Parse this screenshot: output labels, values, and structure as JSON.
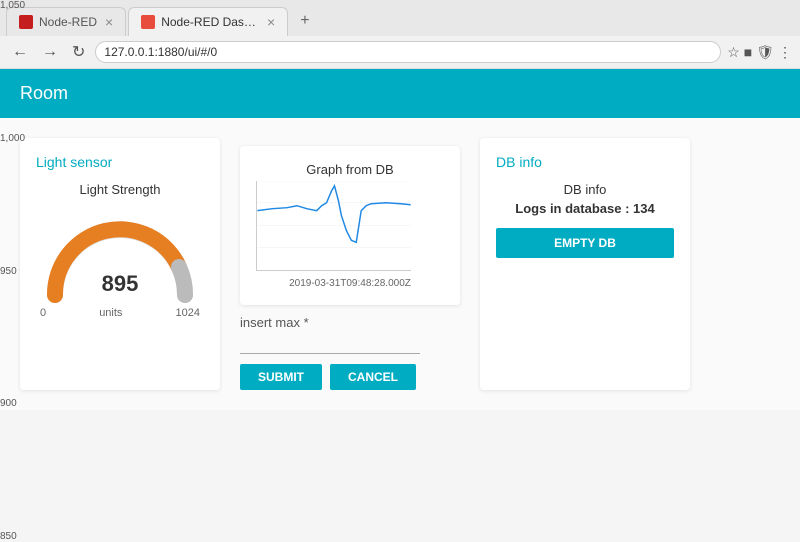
{
  "browser": {
    "tabs": [
      {
        "label": "Node-RED",
        "active": false,
        "favicon_color": "#c41e1e"
      },
      {
        "label": "Node-RED Dashb...",
        "active": true,
        "favicon_color": "#e74c3c"
      }
    ],
    "address": "127.0.0.1:1880/ui/#/0",
    "nav_back": "←",
    "nav_forward": "→",
    "nav_refresh": "↻"
  },
  "header": {
    "title": "Room"
  },
  "light_sensor": {
    "section_title": "Light sensor",
    "gauge_label": "Light Strength",
    "value": "895",
    "unit": "units",
    "range_min": "0",
    "range_max": "1024"
  },
  "graph": {
    "section_title": "Graph from DB",
    "timestamp": "2019-03-31T09:48:28.000Z",
    "y_labels": [
      "1,050",
      "1,000",
      "950",
      "900",
      "850"
    ]
  },
  "insert_form": {
    "label": "insert max *",
    "submit_label": "SUBMIT",
    "cancel_label": "CANCEL"
  },
  "db_info": {
    "section_title": "DB info",
    "info_label": "DB info",
    "logs_label": "Logs in database : 134",
    "empty_db_label": "EMPTY DB"
  }
}
